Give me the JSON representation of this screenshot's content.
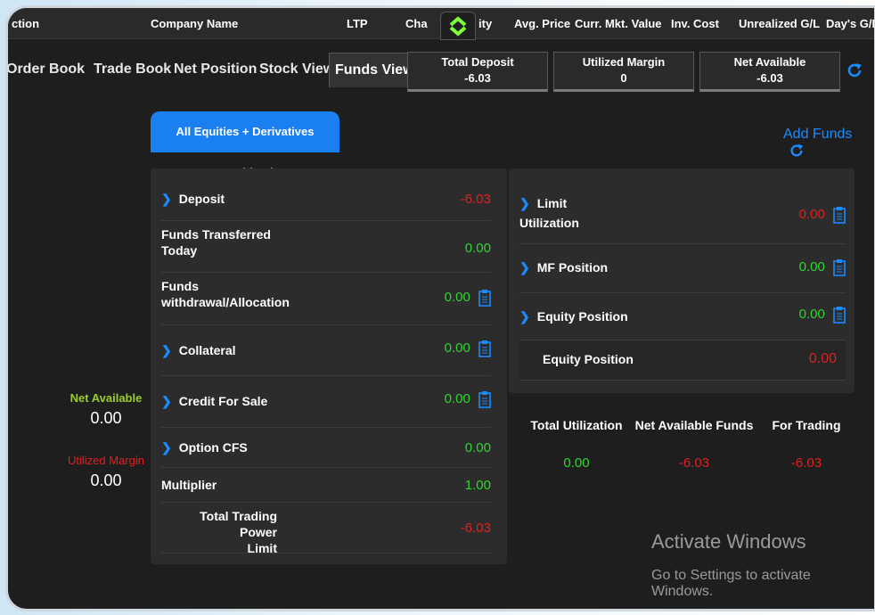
{
  "columns": [
    "ction",
    "Company Name",
    "LTP",
    "Cha",
    "ity",
    "Avg. Price",
    "Curr. Mkt. Value",
    "Inv. Cost",
    "Unrealized G/L",
    "Day's G/L"
  ],
  "tabs": [
    "Order Book",
    "Trade Book",
    "Net Position",
    "Stock View",
    "Funds View"
  ],
  "active_tab": "Funds View",
  "summary": {
    "total_deposit": {
      "label": "Total Deposit",
      "value": "-6.03"
    },
    "utilized_margin": {
      "label": "Utilized Margin",
      "value": "0"
    },
    "net_available": {
      "label": "Net Available",
      "value": "-6.03"
    }
  },
  "segment_button": "All Equities + Derivatives Combined",
  "add_funds": "Add Funds",
  "left_rows": [
    {
      "label": "Deposit",
      "value": "-6.03",
      "expand": true,
      "color": "red",
      "clip": false
    },
    {
      "label": "Funds Transferred\nToday",
      "value": "0.00",
      "expand": false,
      "color": "green",
      "clip": false
    },
    {
      "label": "Funds\nwithdrawal/Allocation",
      "value": "0.00",
      "expand": false,
      "color": "green",
      "clip": true
    },
    {
      "label": "Collateral",
      "value": "0.00",
      "expand": true,
      "color": "green",
      "clip": true
    },
    {
      "label": "Credit For Sale",
      "value": "0.00",
      "expand": true,
      "color": "green",
      "clip": true
    },
    {
      "label": "Option CFS",
      "value": "0.00",
      "expand": true,
      "color": "green",
      "clip": false
    },
    {
      "label": "Multiplier",
      "value": "1.00",
      "expand": false,
      "color": "green",
      "clip": false
    },
    {
      "label": "Total Trading Power\nLimit",
      "value": "-6.03",
      "expand": false,
      "color": "red",
      "clip": false
    }
  ],
  "right_rows": [
    {
      "label": "Limit\nUtilization",
      "value": "0.00",
      "expand": true,
      "color": "red",
      "clip": true
    },
    {
      "label": "MF Position",
      "value": "0.00",
      "expand": true,
      "color": "green",
      "clip": true
    },
    {
      "label": "Equity Position",
      "value": "0.00",
      "expand": true,
      "color": "green",
      "clip": true
    },
    {
      "label": "Equity Position",
      "value": "0.00",
      "expand": false,
      "color": "red",
      "clip": false
    }
  ],
  "side": {
    "net_available_label": "Net Available",
    "net_available_value": "0.00",
    "utilized_margin_label": "Utilized Margin",
    "utilized_margin_value": "0.00"
  },
  "utilization": {
    "total_label": "Total Utilization",
    "total_value": "0.00",
    "net_label": "Net Available Funds",
    "net_value": "-6.03",
    "trading_label": "For Trading",
    "trading_value": "-6.03"
  },
  "watermark": {
    "title": "Activate Windows",
    "subtitle": "Go to Settings to activate Windows."
  },
  "colors": {
    "accent": "#1a8cff",
    "positive": "#2fd62f",
    "negative": "#e02020",
    "label_green": "#9acd32"
  }
}
